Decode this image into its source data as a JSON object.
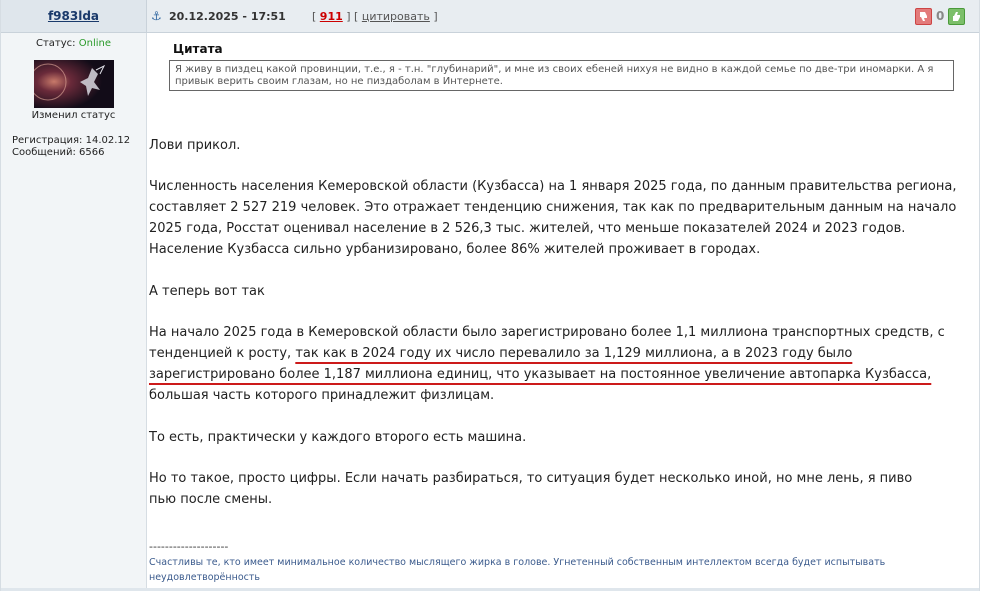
{
  "user": {
    "name": "f983lda",
    "status_label": "Статус:",
    "status_value": "Online",
    "avatar_caption": "Изменил статус",
    "reg_label": "Регистрация: 14.02.12",
    "posts_label": "Сообщений: 6566"
  },
  "header": {
    "anchor_icon": "anchor-icon",
    "date": "20.12.2025 - 17:51",
    "bracket_open": "[",
    "post_number": "911",
    "bracket_mid": "] [",
    "quote_link": "цитировать",
    "bracket_close": "]",
    "rating_value": "0"
  },
  "quote": {
    "title": "Цитата",
    "text": "Я живу в пиздец какой провинции, т.е., я - т.н. \"глубинарий\", и мне из своих ебеней нихуя не видно в каждой семье по две-три иномарки. А я привык верить своим глазам, но не пиздаболам в Интернете."
  },
  "body": {
    "p1": "Лови прикол.",
    "p2": "Численность населения Кемеровской области (Кузбасса) на 1 января 2025 года, по данным правительства региона, составляет 2 527 219 человек. Это отражает тенденцию снижения, так как по предварительным данным на начало 2025 года, Росстат оценивал население в 2 526,3 тыс. жителей, что меньше показателей 2024 и 2023 годов. Население Кузбасса сильно урбанизировано, более 86% жителей проживает в городах.",
    "p3": "А теперь вот так",
    "p4_before": "На начало 2025 года в Кемеровской области было зарегистрировано более 1,1 миллиона транспортных средств, с тенденцией к росту, ",
    "p4_marked": "так как в 2024 году их число перевалило за 1,129 миллиона, а в 2023 году было зарегистрировано более 1,187 миллиона единиц, что указывает на постоянное увеличение автопарка Кузбасса,",
    "p4_after": " большая часть которого принадлежит физлицам.",
    "p5": "То есть, практически у каждого второго есть машина.",
    "p6": "Но то такое, просто цифры. Если начать разбираться, то ситуация будет несколько иной, но мне лень, я пиво пью после смены."
  },
  "signature": {
    "separator": "--------------------",
    "text": "Счастливы те, кто имеет минимальное количество мыслящего жирка в голове. Угнетенный собственным интеллектом всегда будет испытывать неудовлетворённость"
  },
  "colors": {
    "online": "#2a9a2a",
    "post_number": "#cc0000",
    "underline_mark": "#cc1a1a",
    "signature": "#3a5a8c"
  }
}
